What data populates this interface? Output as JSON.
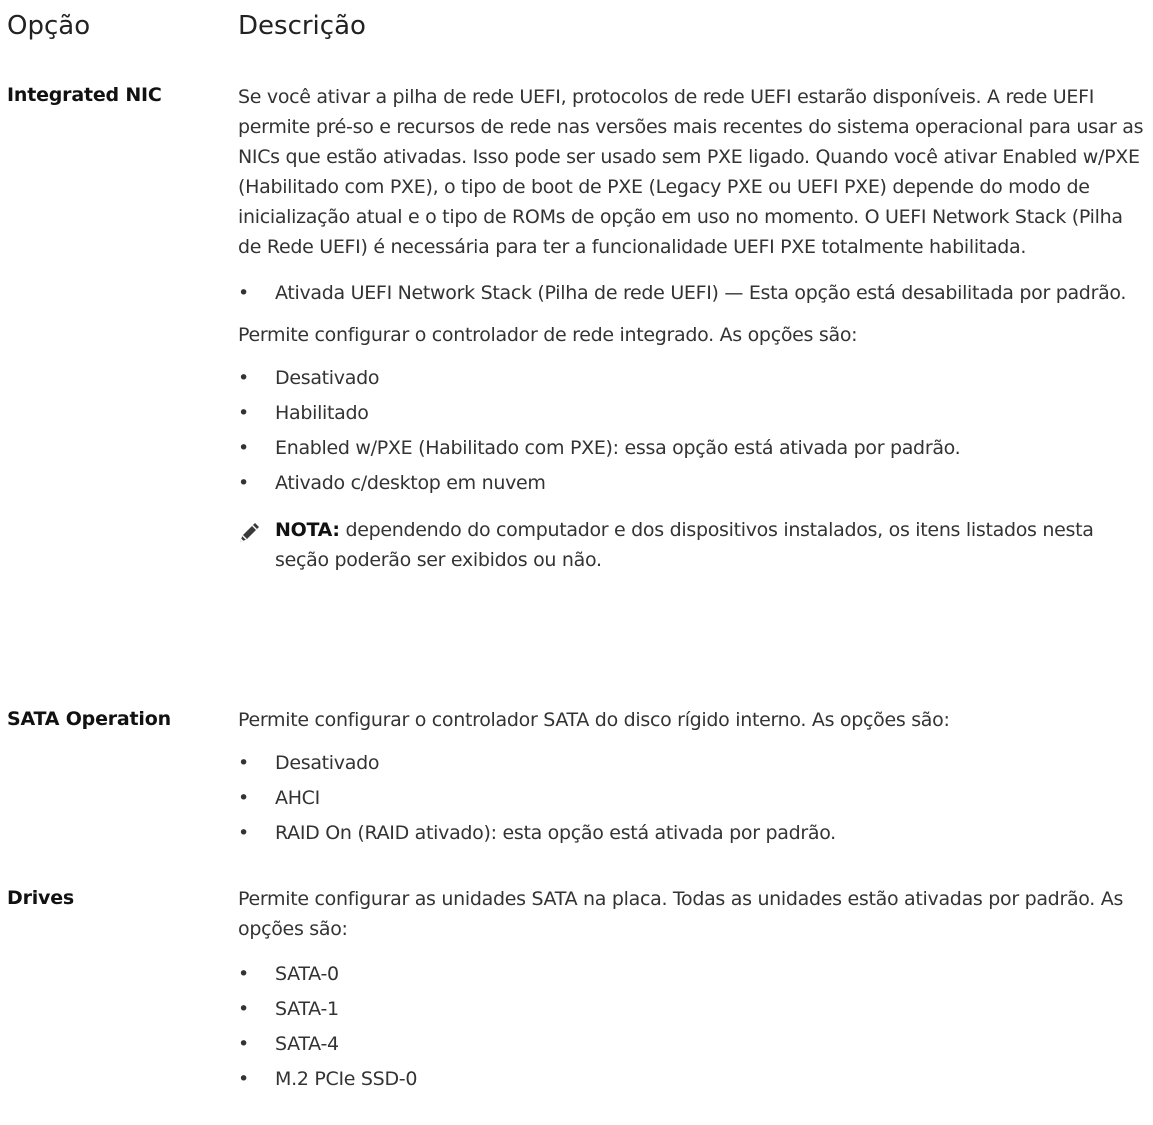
{
  "header": {
    "col_option": "Opção",
    "col_description": "Descrição"
  },
  "sections": [
    {
      "label": "Integrated NIC",
      "paragraph": "Se você ativar a pilha de rede UEFI, protocolos de rede UEFI estarão disponíveis. A rede UEFI permite pré-so e recursos de rede nas versões mais recentes do sistema operacional para usar as NICs que estão ativadas. Isso pode ser usado sem PXE ligado. Quando você ativar Enabled w/PXE (Habilitado com PXE), o tipo de boot de PXE (Legacy PXE ou UEFI PXE) depende do modo de inicialização atual e o tipo de ROMs de opção em uso no momento. O UEFI Network Stack (Pilha de Rede UEFI) é necessária para ter a funcionalidade UEFI PXE totalmente habilitada.",
      "bullet_a": "Ativada UEFI Network Stack (Pilha de rede UEFI) — Esta opção está desabilitada por padrão.",
      "intro": "Permite configurar o controlador de rede integrado. As opções são:",
      "options": [
        "Desativado",
        "Habilitado",
        "Enabled w/PXE (Habilitado com PXE): essa opção está ativada por padrão.",
        "Ativado c/desktop em nuvem"
      ],
      "note_label": "NOTA:",
      "note_text": "dependendo do computador e dos dispositivos instalados, os itens listados nesta seção poderão ser exibidos ou não.",
      "note_icon": "pencil-note-icon"
    },
    {
      "label": "SATA Operation",
      "intro": "Permite configurar o controlador SATA do disco rígido interno. As opções são:",
      "options": [
        "Desativado",
        "AHCI",
        "RAID On (RAID ativado): esta opção está ativada por padrão."
      ]
    },
    {
      "label": "Drives",
      "intro": "Permite configurar as unidades SATA na placa. Todas as unidades estão ativadas por padrão. As opções são:",
      "options": [
        "SATA-0",
        "SATA-1",
        "SATA-4",
        "M.2 PCIe SSD-0"
      ]
    }
  ],
  "bullet_char": "•"
}
